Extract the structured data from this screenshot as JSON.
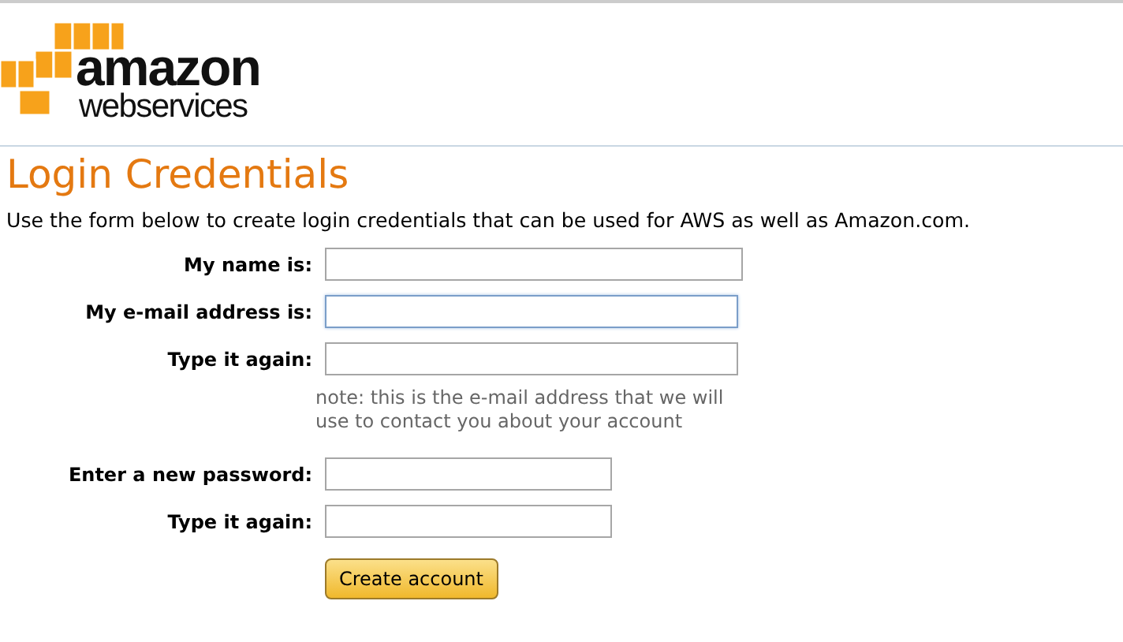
{
  "logo": {
    "line_1": "amazon",
    "line_2": "webservices"
  },
  "title": "Login Credentials",
  "intro": "Use the form below to create login credentials that can be used for AWS as well as Amazon.com.",
  "fields": [
    {
      "label": "My name is:",
      "kind": "text",
      "focused": false
    },
    {
      "label": "My e-mail address is:",
      "kind": "email",
      "focused": true
    },
    {
      "label": "Type it again:",
      "kind": "email",
      "focused": false
    },
    {
      "kind": "note",
      "text": "note: this is the e-mail address that we will use to contact you about your account"
    },
    {
      "label": "Enter a new password:",
      "kind": "password",
      "focused": false
    },
    {
      "label": "Type it again:",
      "kind": "password",
      "focused": false
    }
  ],
  "submit_button": "Create account"
}
